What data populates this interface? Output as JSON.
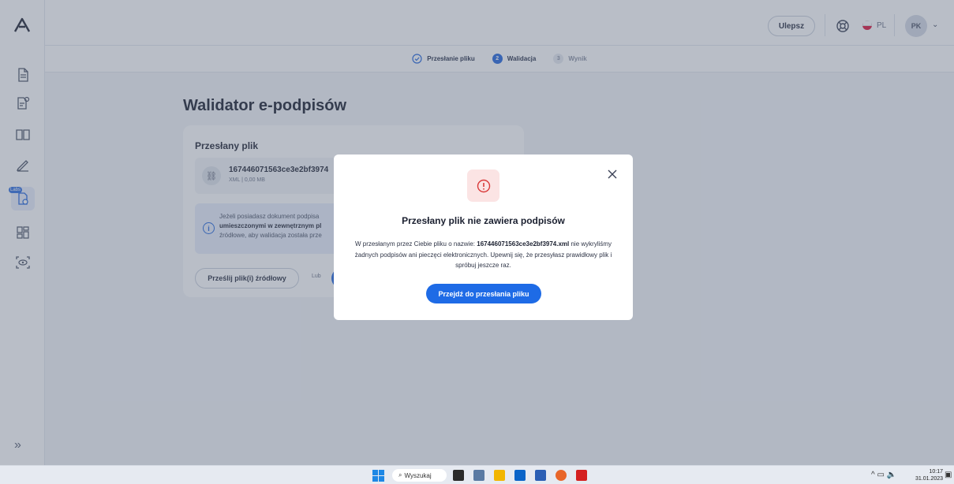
{
  "topbar": {
    "upgrade_label": "Ulepsz",
    "lang_label": "PL",
    "avatar_initials": "PK"
  },
  "stepper": {
    "steps": [
      {
        "label": "Przesłanie pliku",
        "num": ""
      },
      {
        "label": "Walidacja",
        "num": "2"
      },
      {
        "label": "Wynik",
        "num": "3"
      }
    ]
  },
  "sidebar": {
    "labs_badge": "Labs"
  },
  "main": {
    "title": "Walidator e-podpisów",
    "card": {
      "title": "Przesłany plik",
      "file_name": "167446071563ce3e2bf3974",
      "file_meta": "XML | 0,00 MB",
      "info_line1": "Jeżeli posiadasz dokument podpisa",
      "info_line2_bold": "umieszczonymi w zewnętrznym pl",
      "info_line3": "źródłowe, aby walidacja została prze",
      "source_button": "Prześlij plik(i) źródłowy",
      "or_label": "Lub"
    }
  },
  "modal": {
    "title": "Przesłany plik nie zawiera podpisów",
    "body_pre": "W przesłanym przez Ciebie pliku o nazwie: ",
    "body_file": "167446071563ce3e2bf3974.xml",
    "body_post": " nie wykryliśmy żadnych podpisów ani pieczęci elektronicznych. Upewnij się, że przesyłasz prawidłowy plik i spróbuj jeszcze raz.",
    "button": "Przejdź do przesłania pliku"
  },
  "taskbar": {
    "search": "Wyszukaj",
    "time": "10:17",
    "date": "31.01.2023"
  },
  "colors": {
    "accent": "#1e6be6",
    "alert_bg": "#fbe4e4",
    "alert": "#d93a3a"
  }
}
